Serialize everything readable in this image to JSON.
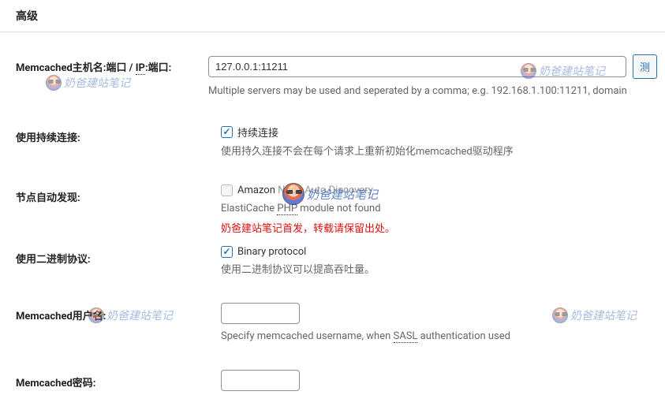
{
  "header": {
    "title": "高级"
  },
  "fields": {
    "host": {
      "label_prefix": "Memcached主机名:端口 / ",
      "label_dotted": "IP",
      "label_suffix": ":端口:",
      "value": "127.0.0.1:11211",
      "test_button": "测",
      "desc": "Multiple servers may be used and seperated by a comma; e.g. 192.168.1.100:11211, domain"
    },
    "persistent": {
      "label": "使用持续连接:",
      "checkbox_label": "持续连接",
      "checked": true,
      "desc": "使用持久连接不会在每个请求上重新初始化memcached驱动程序"
    },
    "autodiscovery": {
      "label": "节点自动发现:",
      "checkbox_label_prefix": "Amazon",
      "checkbox_label_mid": "Node Auto Discovery",
      "checked": false,
      "desc_prefix": "ElastiCache ",
      "desc_dotted": "PHP",
      "desc_suffix": " module not found",
      "red_note": "奶爸建站笔记首发，转载请保留出处。"
    },
    "binary": {
      "label": "使用二进制协议:",
      "checkbox_label": "Binary protocol",
      "checked": true,
      "desc": "使用二进制协议可以提高吞吐量。"
    },
    "username": {
      "label": "Memcached用户名:",
      "value": "",
      "desc_prefix": "Specify memcached username, when ",
      "desc_dotted": "SASL",
      "desc_suffix": " authentication used"
    },
    "password": {
      "label": "Memcached密码:",
      "value": ""
    }
  },
  "watermark_text": "奶爸建站笔记"
}
